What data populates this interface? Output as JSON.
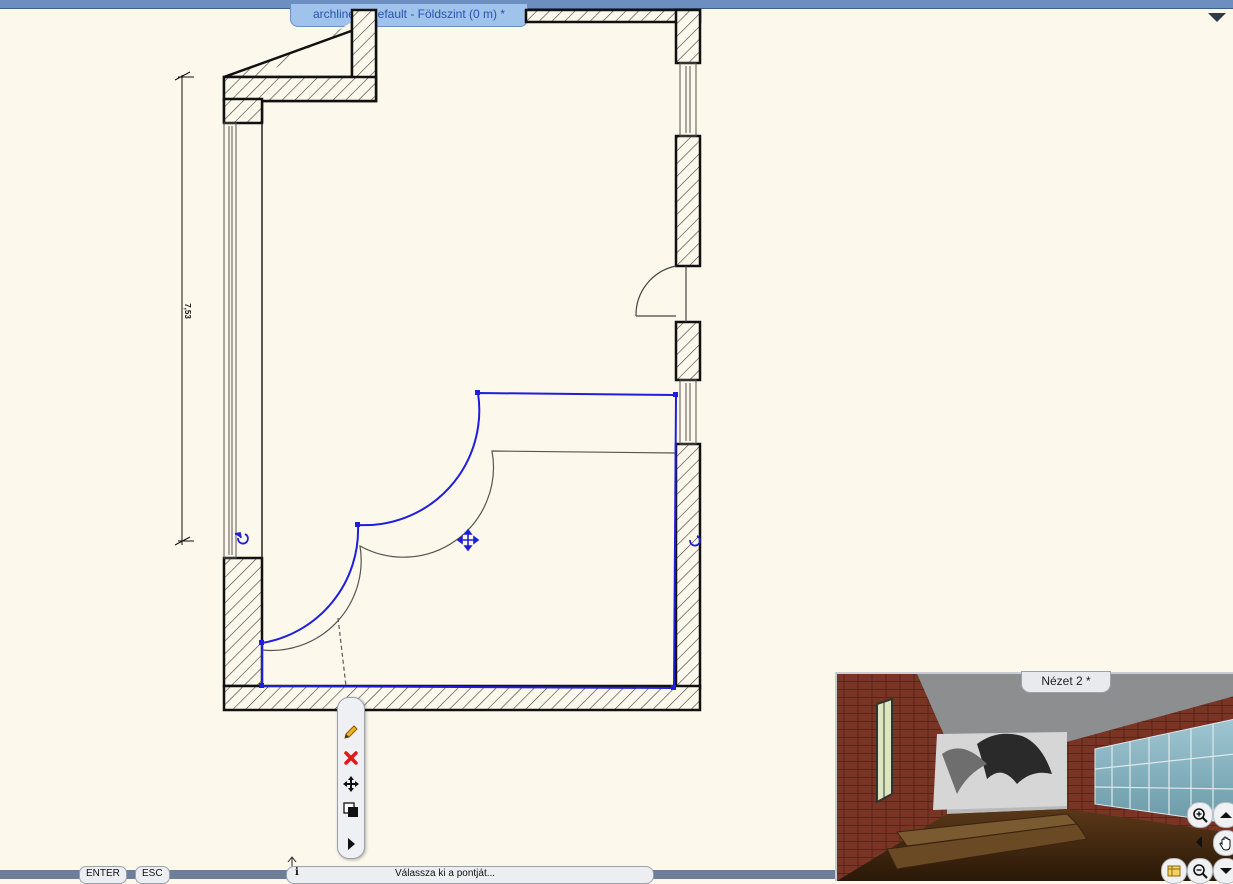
{
  "window": {
    "doc_title": "archline1 -Default - Földszint (0 m) *"
  },
  "plan": {
    "dimension_label": "7,53"
  },
  "view2": {
    "title": "Nézet 2 *"
  },
  "statusbar": {
    "enter_label": "ENTER",
    "esc_label": "ESC",
    "hint_text": "Válassza ki a pontját..."
  },
  "float_toolbar": [
    "pencil-icon",
    "delete-icon",
    "move-icon",
    "copy-icon",
    "expand-arrow-icon"
  ],
  "nav": [
    "zoom-in-icon",
    "arrow-up-icon",
    "arrow-left-icon",
    "pan-hand-icon",
    "layers-icon",
    "zoom-out-icon",
    "arrow-down-icon"
  ],
  "colors": {
    "selection": "#1e1edc",
    "background": "#fdf8ec",
    "tab": "#9fc3ea",
    "tab_text": "#2a52b0"
  }
}
